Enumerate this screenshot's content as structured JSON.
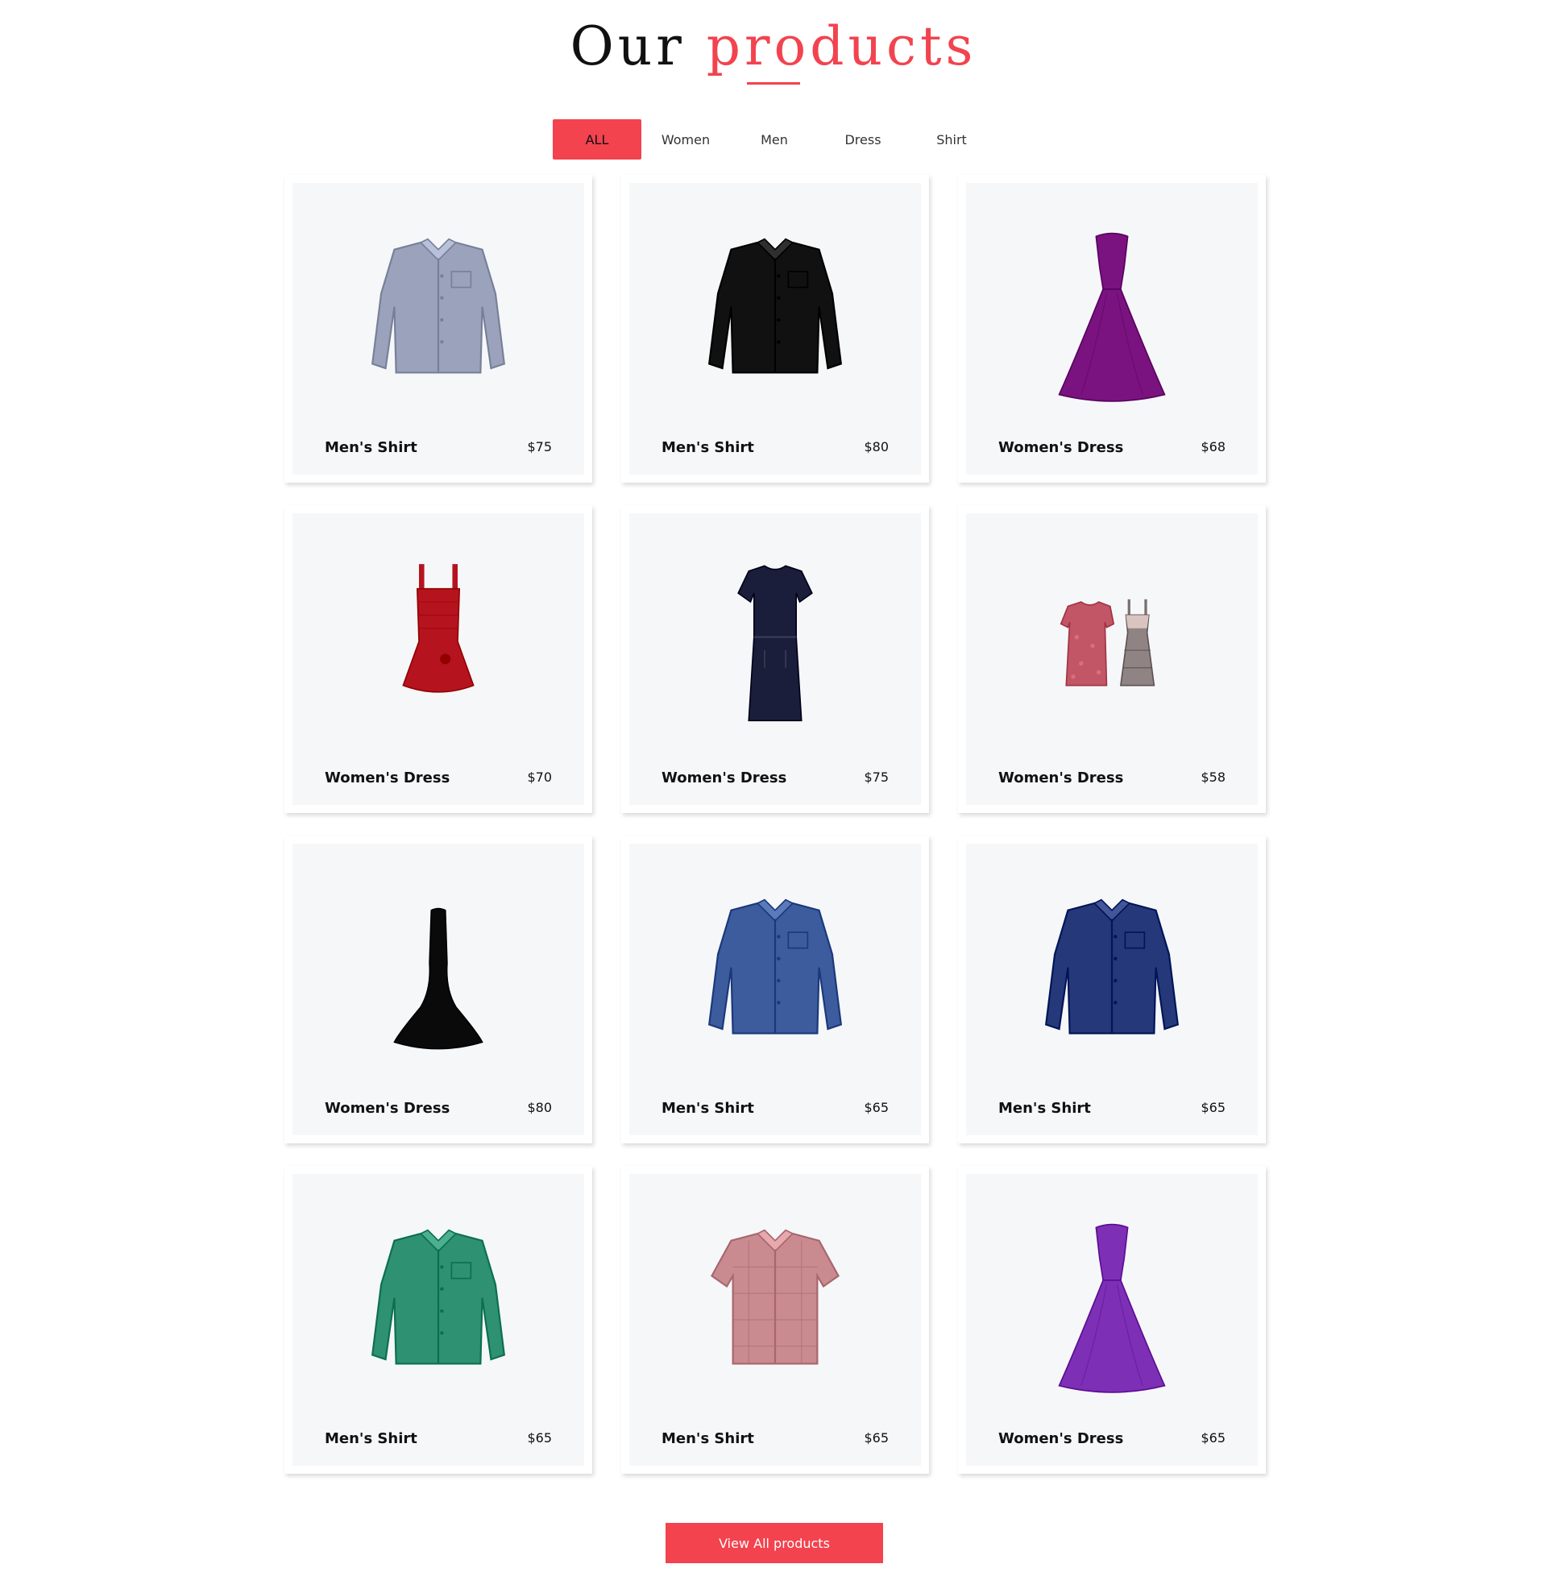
{
  "section": {
    "title_part1": "Our",
    "title_part2": "products",
    "accent_color": "#f2434f"
  },
  "filters": [
    {
      "label": "ALL",
      "active": true
    },
    {
      "label": "Women",
      "active": false
    },
    {
      "label": "Men",
      "active": false
    },
    {
      "label": "Dress",
      "active": false
    },
    {
      "label": "Shirt",
      "active": false
    }
  ],
  "products": [
    {
      "name": "Men's Shirt",
      "price": "$75",
      "image": "shirt-icon",
      "color": "#9aa3bb",
      "kind": "shirt"
    },
    {
      "name": "Men's Shirt",
      "price": "$80",
      "image": "shirt-icon",
      "color": "#111111",
      "kind": "shirt"
    },
    {
      "name": "Women's Dress",
      "price": "$68",
      "image": "gown-icon",
      "color": "#7a1380",
      "kind": "gown"
    },
    {
      "name": "Women's Dress",
      "price": "$70",
      "image": "dress-icon",
      "color": "#b5141e",
      "kind": "short-dress"
    },
    {
      "name": "Women's Dress",
      "price": "$75",
      "image": "dress-icon",
      "color": "#1b1e3a",
      "kind": "sheath-dress"
    },
    {
      "name": "Women's Dress",
      "price": "$58",
      "image": "dresses-icon",
      "color": "#c25566",
      "kind": "two-dresses"
    },
    {
      "name": "Women's Dress",
      "price": "$80",
      "image": "dress-icon",
      "color": "#0a0a0a",
      "kind": "mermaid-dress"
    },
    {
      "name": "Men's Shirt",
      "price": "$65",
      "image": "shirt-icon",
      "color": "#3d5c9e",
      "kind": "shirt"
    },
    {
      "name": "Men's Shirt",
      "price": "$65",
      "image": "shirt-icon",
      "color": "#24387a",
      "kind": "shirt"
    },
    {
      "name": "Men's Shirt",
      "price": "$65",
      "image": "shirt-icon",
      "color": "#2e9272",
      "kind": "shirt"
    },
    {
      "name": "Men's Shirt",
      "price": "$65",
      "image": "shirt-icon",
      "color": "#c98a90",
      "kind": "short-shirt"
    },
    {
      "name": "Women's Dress",
      "price": "$65",
      "image": "gown-icon",
      "color": "#7d2fb5",
      "kind": "gown"
    }
  ],
  "view_all_label": "View All products"
}
